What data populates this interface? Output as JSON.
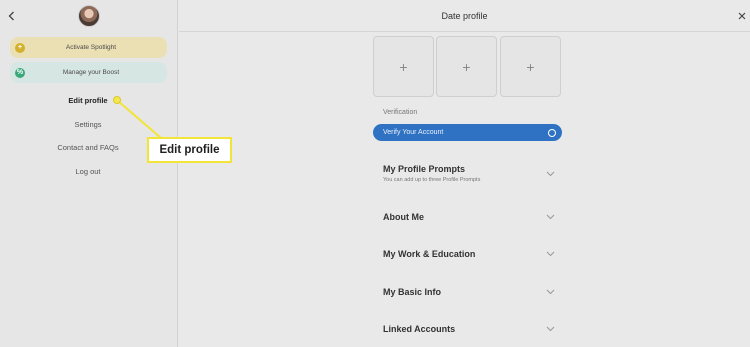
{
  "sidebar": {
    "promos": [
      {
        "label": "Activate Spotlight",
        "badge": "+"
      },
      {
        "label": "Manage your Boost",
        "badge": "%"
      }
    ],
    "menu": [
      "Edit profile",
      "Settings",
      "Contact and FAQs",
      "Log out"
    ]
  },
  "callout": {
    "text": "Edit profile"
  },
  "main": {
    "title": "Date profile",
    "photo_slots": [
      "+",
      "+",
      "+"
    ],
    "verification": {
      "label": "Verification",
      "button_label": "Verify Your Account"
    },
    "sections": [
      {
        "title": "My Profile Prompts",
        "subtitle": "You can add up to three Profile Prompts"
      },
      {
        "title": "About Me"
      },
      {
        "title": "My Work & Education"
      },
      {
        "title": "My Basic Info"
      },
      {
        "title": "Linked Accounts"
      }
    ]
  },
  "colors": {
    "accent": "#2f72c4",
    "spotlight": "#ebdfb4",
    "boost": "#d6e6e3",
    "callout": "#f3e43a"
  },
  "icons": [
    "chevron-left-icon",
    "close-icon",
    "plus-icon",
    "chevron-down-icon"
  ]
}
